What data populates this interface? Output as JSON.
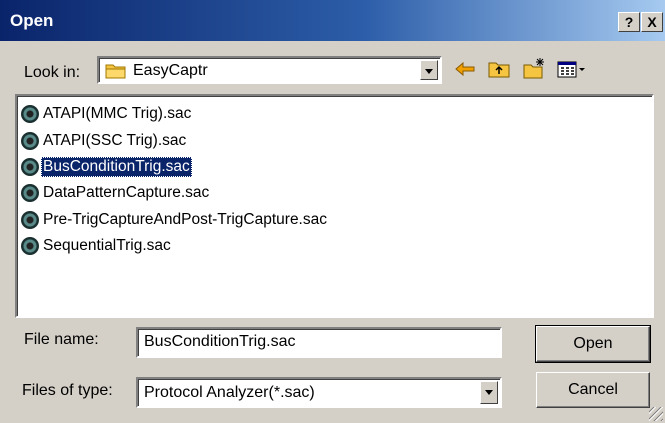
{
  "dialog": {
    "title": "Open",
    "help_label": "?",
    "close_label": "X"
  },
  "look_in": {
    "label": "Look in:",
    "value": "EasyCaptr"
  },
  "toolbar": {
    "icons": [
      "back-arrow-icon",
      "up-one-level-icon",
      "create-new-folder-icon",
      "view-menu-icon"
    ],
    "accent_color": "#f0a000"
  },
  "files": [
    {
      "name": "ATAPI(MMC Trig).sac",
      "selected": false
    },
    {
      "name": "ATAPI(SSC Trig).sac",
      "selected": false
    },
    {
      "name": "BusConditionTrig.sac",
      "selected": true
    },
    {
      "name": "DataPatternCapture.sac",
      "selected": false
    },
    {
      "name": "Pre-TrigCaptureAndPost-TrigCapture.sac",
      "selected": false
    },
    {
      "name": "SequentialTrig.sac",
      "selected": false
    }
  ],
  "file_name": {
    "label": "File name:",
    "value": "BusConditionTrig.sac"
  },
  "file_type": {
    "label": "Files of type:",
    "value": "Protocol Analyzer(*.sac)"
  },
  "buttons": {
    "open_label": "Open",
    "cancel_label": "Cancel"
  },
  "colors": {
    "title_bar": "#0a246a",
    "selection": "#0a246a",
    "face": "#d4d0c8"
  }
}
